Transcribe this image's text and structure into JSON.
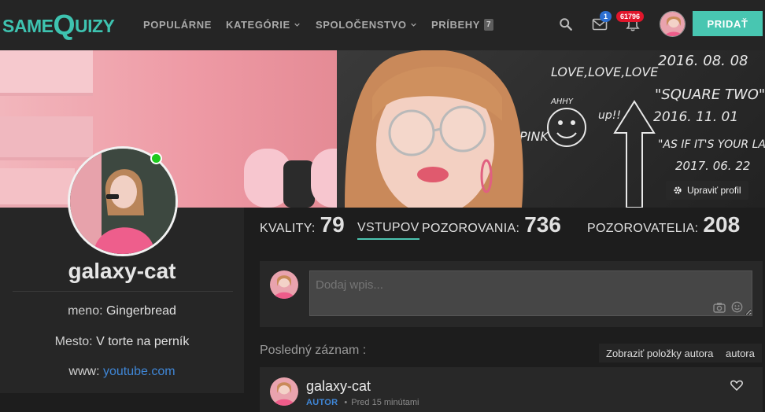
{
  "brand": {
    "logo_part1": "SAME",
    "logo_part2": "Q",
    "logo_part3": "UIZY"
  },
  "nav": {
    "items": [
      {
        "label": "POPULÁRNE"
      },
      {
        "label": "KATEGÓRIE"
      },
      {
        "label": "SPOLOČENSTVO"
      },
      {
        "label": "PRÍBEHY",
        "badge": "7"
      }
    ],
    "messages_count": "1",
    "notifications_count": "61796",
    "add_button": "PRIDAŤ",
    "icons": [
      "search-icon",
      "envelope-icon",
      "bell-icon"
    ]
  },
  "cover": {
    "edit_button": "Upraviť profil",
    "chalk": [
      "2016. 08. 08",
      "LOVE,LOVE,LOVE",
      "\"SQUARE TWO\"",
      "2016. 11. 01",
      "\"AS IF IT'S YOUR LAST\"",
      "2017. 06. 22",
      "PINK",
      "up!!",
      "AHHY"
    ]
  },
  "profile": {
    "username": "galaxy-cat",
    "online": true,
    "name_label": "meno:",
    "name_value": "Gingerbread",
    "city_label": "Mesto:",
    "city_value": "V torte na perník",
    "web_label": "www:",
    "web_value": "youtube.com"
  },
  "stats": {
    "qualities_label": "KVALITY:",
    "qualities_value": "79",
    "entries_label": "VSTUPOV",
    "watching_label": "POZOROVANIA:",
    "watching_value": "736",
    "watchers_label": "POZOROVATELIA:",
    "watchers_value": "208"
  },
  "composer": {
    "placeholder": "Dodaj wpis...",
    "icons": [
      "camera-icon",
      "smiley-icon"
    ]
  },
  "latest": {
    "label": "Posledný záznam :",
    "filter_author_items": "Zobraziť položky autora",
    "filter_author": "autora"
  },
  "entry": {
    "author": "galaxy-cat",
    "role": "AUTOR",
    "time": "Pred 15 minútami"
  },
  "colors": {
    "accent": "#48c6b1",
    "link": "#3f86d6",
    "notification_badge": "#e0162b",
    "message_badge": "#2d6fd1",
    "online": "#1ec91e"
  }
}
